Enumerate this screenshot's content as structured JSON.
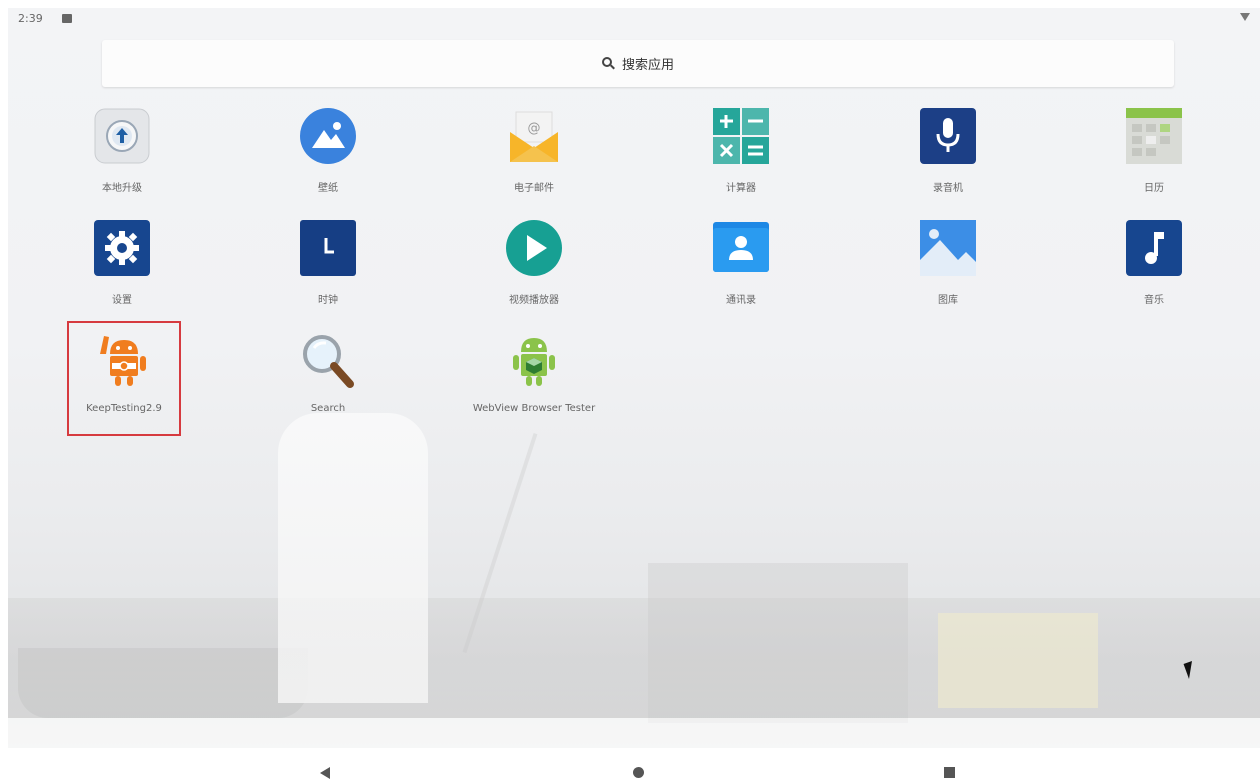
{
  "status_bar": {
    "time": "2:39"
  },
  "search": {
    "label": "搜索应用",
    "icon": "search-icon"
  },
  "apps": [
    {
      "label": "本地升级",
      "icon": "upgrade-icon"
    },
    {
      "label": "壁纸",
      "icon": "wallpaper-icon"
    },
    {
      "label": "电子邮件",
      "icon": "email-icon"
    },
    {
      "label": "计算器",
      "icon": "calculator-icon"
    },
    {
      "label": "录音机",
      "icon": "recorder-icon"
    },
    {
      "label": "日历",
      "icon": "calendar-icon"
    },
    {
      "label": "设置",
      "icon": "settings-icon"
    },
    {
      "label": "时钟",
      "icon": "clock-icon"
    },
    {
      "label": "视频播放器",
      "icon": "video-player-icon"
    },
    {
      "label": "通讯录",
      "icon": "contacts-icon"
    },
    {
      "label": "图库",
      "icon": "gallery-icon"
    },
    {
      "label": "音乐",
      "icon": "music-icon"
    },
    {
      "label": "KeepTesting2.9",
      "icon": "keeptesting-android-icon"
    },
    {
      "label": "Search",
      "icon": "magnifier-icon"
    },
    {
      "label": "WebView Browser Tester",
      "icon": "webview-android-icon"
    }
  ],
  "nav": {
    "back": "back-icon",
    "home": "home-icon",
    "recents": "recents-icon"
  },
  "colors": {
    "highlight": "#d63a3f",
    "accent_blue": "#1e5fa5"
  }
}
